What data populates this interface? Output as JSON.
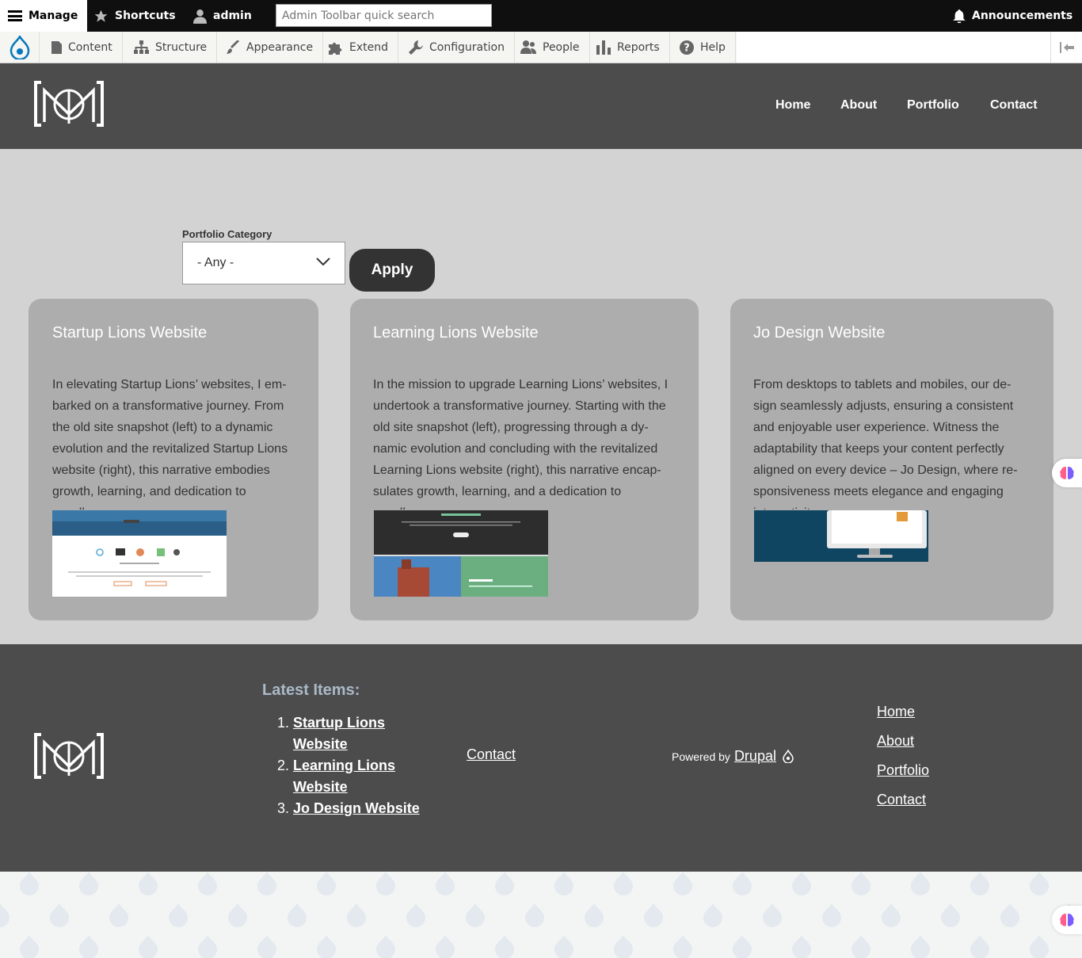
{
  "toolbar": {
    "manage_label": "Manage",
    "shortcuts_label": "Shortcuts",
    "user_label": "admin",
    "search_placeholder": "Admin Toolbar quick search",
    "announcements_label": "Announcements",
    "nav": [
      {
        "label": "Content",
        "icon": "document-icon"
      },
      {
        "label": "Structure",
        "icon": "sitemap-icon"
      },
      {
        "label": "Appearance",
        "icon": "paintbrush-icon"
      },
      {
        "label": "Extend",
        "icon": "puzzle-icon"
      },
      {
        "label": "Configuration",
        "icon": "wrench-icon"
      },
      {
        "label": "People",
        "icon": "people-icon"
      },
      {
        "label": "Reports",
        "icon": "bar-chart-icon"
      },
      {
        "label": "Help",
        "icon": "help-icon"
      }
    ]
  },
  "header": {
    "nav": [
      "Home",
      "About",
      "Portfolio",
      "Contact"
    ]
  },
  "filter": {
    "label": "Portfolio Category",
    "selected": "- Any -",
    "apply_label": "Apply"
  },
  "cards": [
    {
      "title": "Startup Lions Website",
      "body": "In elevating Startup Lions’ websites, I em­barked on a transformative journey. From the old site snapshot (left) to a dynamic evolution and the revitalized Startup Lions website (right), this narrative embodies growth, learning, and dedication to excellence."
    },
    {
      "title": "Learning Lions Website",
      "body": "In the mission to upgrade Learning Lions’ websites, I undertook a transformative journey. Starting with the old site snapshot (left), progressing through a dy­namic evolution and concluding with the revitalized Learning Lions website (right), this narrative encap­sulates growth, learning, and a dedication to excellence."
    },
    {
      "title": "Jo Design Website",
      "body": "From desktops to tablets and mobiles, our de­sign seamlessly adjusts, ensuring a consistent and enjoyable user experience. Witness the adaptability that keeps your content perfectly aligned on every device – Jo Design, where re­sponsiveness meets elegance and engaging interactivity."
    }
  ],
  "footer": {
    "latest_title": "Latest Items:",
    "latest_items": [
      "Startup Lions Website",
      "Learning Lions Website",
      "Jo Design Website"
    ],
    "contact_label": "Contact",
    "powered_by": "Powered by",
    "drupal": "Drupal",
    "nav": [
      "Home",
      "About",
      "Portfolio",
      "Contact"
    ]
  },
  "colors": {
    "header_bg": "#4d4c4d",
    "main_bg": "#d3d3d3",
    "card_bg": "#adadad",
    "apply_bg": "#333333",
    "drupal_blue": "#0678be",
    "latest_title": "#a9b9c8"
  }
}
